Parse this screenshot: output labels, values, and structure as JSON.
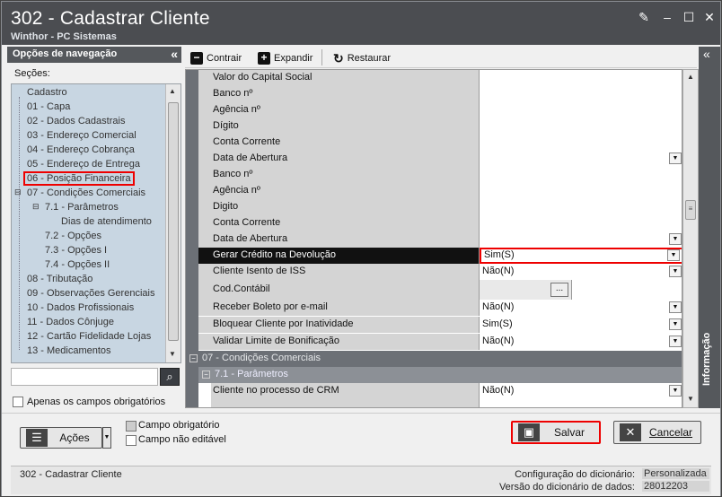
{
  "window": {
    "title": "302 - Cadastrar Cliente",
    "subtitle": "Winthor - PC Sistemas"
  },
  "nav": {
    "header": "Opções de navegação",
    "sections_label": "Seções:",
    "tree": [
      "Cadastro",
      "01 - Capa",
      "02 - Dados Cadastrais",
      "03 - Endereço Comercial",
      "04 - Endereço Cobrança",
      "05 - Endereço de Entrega",
      "06 - Posição Financeira",
      "07 - Condições Comerciais",
      "7.1 - Parâmetros",
      "Dias de atendimento",
      "7.2 - Opções",
      "7.3 - Opções I",
      "7.4 - Opções II",
      "08 - Tributação",
      "09 - Observações Gerenciais",
      "10 - Dados Profissionais",
      "11 - Dados Cônjuge",
      "12 - Cartão Fidelidade Lojas",
      "13 - Medicamentos"
    ],
    "required_only_label": "Apenas os campos obrigatórios"
  },
  "toolbar": {
    "collapse_label": "Contrair",
    "expand_label": "Expandir",
    "restore_label": "Restaurar"
  },
  "grid": {
    "rows": [
      {
        "label": "Valor do Capital Social",
        "value": ""
      },
      {
        "label": "Banco nº",
        "value": ""
      },
      {
        "label": "Agência nº",
        "value": ""
      },
      {
        "label": "Dígito",
        "value": ""
      },
      {
        "label": "Conta Corrente",
        "value": ""
      },
      {
        "label": "Data de Abertura",
        "value": ""
      },
      {
        "label": "Banco nº",
        "value": ""
      },
      {
        "label": "Agência nº",
        "value": ""
      },
      {
        "label": "Digito",
        "value": ""
      },
      {
        "label": "Conta Corrente",
        "value": ""
      },
      {
        "label": "Data de Abertura",
        "value": ""
      },
      {
        "label": "Gerar Crédito na Devolução",
        "value": "Sim(S)"
      },
      {
        "label": "Cliente Isento de ISS",
        "value": "Não(N)"
      },
      {
        "label": "Cod.Contábil",
        "value": "..."
      },
      {
        "label": "Receber Boleto por e-mail",
        "value": "Não(N)"
      },
      {
        "label": "Bloquear Cliente por Inatividade",
        "value": "Sim(S)"
      },
      {
        "label": "Validar Limite de Bonificação",
        "value": "Não(N)"
      }
    ],
    "group_label": "07 - Condições Comerciais",
    "subgroup_label": "7.1 - Parâmetros",
    "crm_row": {
      "label": "Cliente no processo de CRM",
      "value": "Não(N)"
    }
  },
  "info_panel_label": "Informação",
  "legend": {
    "required": "Campo obrigatório",
    "not_editable": "Campo não editável"
  },
  "buttons": {
    "actions": "Ações",
    "save": "Salvar",
    "cancel": "Cancelar"
  },
  "status": {
    "left": "302 - Cadastrar Cliente",
    "config_key": "Configuração do dicionário:",
    "config_value": "Personalizada",
    "version_key": "Versão do dicionário de dados:",
    "version_value": "28012203"
  }
}
